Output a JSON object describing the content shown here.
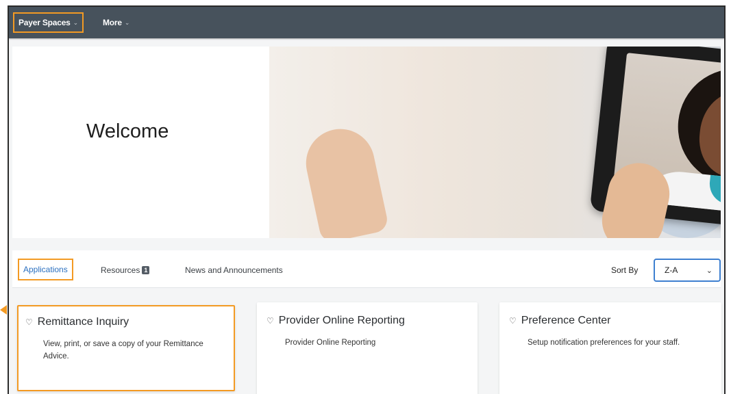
{
  "nav": {
    "items": [
      {
        "label": "Payer Spaces"
      },
      {
        "label": "More"
      }
    ],
    "chevron": "⌄"
  },
  "banner": {
    "welcome": "Welcome"
  },
  "tabs": {
    "items": [
      {
        "label": "Applications"
      },
      {
        "label": "Resources",
        "badge": "1"
      },
      {
        "label": "News and Announcements"
      }
    ]
  },
  "sort": {
    "label": "Sort By",
    "value": "Z-A"
  },
  "cards": [
    {
      "title": "Remittance Inquiry",
      "desc": "View, print, or save a copy of your Remittance Advice."
    },
    {
      "title": "Provider Online Reporting",
      "desc": "Provider Online Reporting"
    },
    {
      "title": "Preference Center",
      "desc": "Setup notification preferences for your staff."
    }
  ],
  "colors": {
    "highlight": "#f39a23",
    "nav_bg": "#47525c",
    "link": "#2a6fbf"
  },
  "icons": [
    "heart-icon",
    "chevron-down-icon"
  ]
}
